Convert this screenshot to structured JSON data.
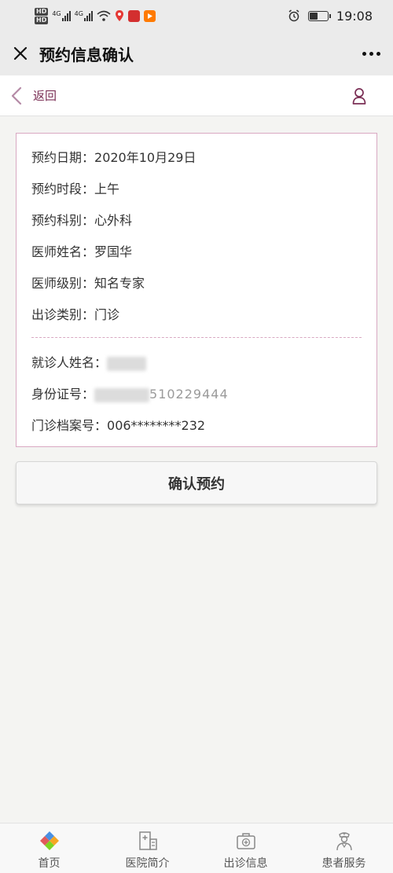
{
  "status_bar": {
    "hd1": "HD",
    "hd2": "HD",
    "net1": "4G",
    "net2": "4G",
    "time": "19:08",
    "battery_level": 0.45
  },
  "title_bar": {
    "close_icon": "close-icon",
    "title": "预约信息确认",
    "more_icon": "more-icon"
  },
  "nav": {
    "back_label": "返回",
    "user_icon": "user-icon"
  },
  "appointment": {
    "date": {
      "label": "预约日期：",
      "value": "2020年10月29日"
    },
    "period": {
      "label": "预约时段：",
      "value": "上午"
    },
    "department": {
      "label": "预约科别：",
      "value": "心外科"
    },
    "doctor_name": {
      "label": "医师姓名：",
      "value": "罗国华"
    },
    "doctor_level": {
      "label": "医师级别：",
      "value": "知名专家"
    },
    "visit_type": {
      "label": "出诊类别：",
      "value": "门诊"
    }
  },
  "patient": {
    "name": {
      "label": "就诊人姓名："
    },
    "id_card": {
      "label": "身份证号：",
      "visible_part": "510229444"
    },
    "record_no": {
      "label": "门诊档案号：",
      "value": "006********232"
    }
  },
  "confirm_button": {
    "label": "确认预约"
  },
  "tabs": [
    {
      "label": "首页",
      "icon": "home-icon"
    },
    {
      "label": "医院简介",
      "icon": "hospital-icon"
    },
    {
      "label": "出诊信息",
      "icon": "medical-kit-icon"
    },
    {
      "label": "患者服务",
      "icon": "nurse-icon"
    }
  ],
  "colors": {
    "accent": "#7a2e54",
    "card_border": "#d9a9c2",
    "background": "#f4f4f2"
  }
}
